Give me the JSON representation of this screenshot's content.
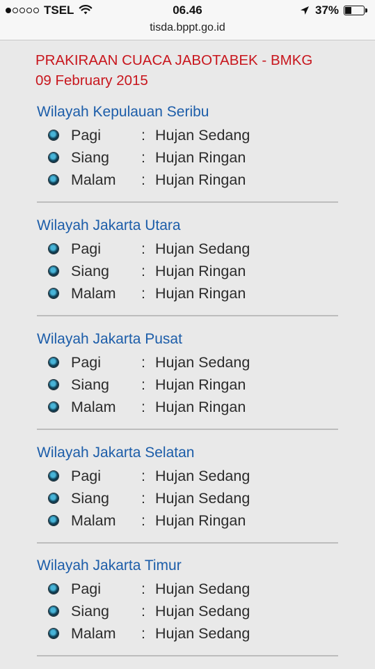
{
  "status_bar": {
    "carrier": "TSEL",
    "time": "06.46",
    "battery_percent": "37%",
    "battery_level": 0.37,
    "signal_bars_filled": 1,
    "signal_bars_total": 5
  },
  "browser": {
    "url": "tisda.bppt.go.id"
  },
  "page": {
    "title": "PRAKIRAAN CUACA JABOTABEK - BMKG 09 February 2015",
    "sections": [
      {
        "region": "Wilayah Kepulauan Seribu",
        "forecasts": [
          {
            "period": "Pagi",
            "colon": ":",
            "weather": "Hujan Sedang"
          },
          {
            "period": "Siang",
            "colon": ":",
            "weather": "Hujan Ringan"
          },
          {
            "period": "Malam",
            "colon": ":",
            "weather": "Hujan Ringan"
          }
        ]
      },
      {
        "region": "Wilayah Jakarta Utara",
        "forecasts": [
          {
            "period": "Pagi",
            "colon": ":",
            "weather": "Hujan Sedang"
          },
          {
            "period": "Siang",
            "colon": ":",
            "weather": "Hujan Ringan"
          },
          {
            "period": "Malam",
            "colon": ":",
            "weather": "Hujan Ringan"
          }
        ]
      },
      {
        "region": "Wilayah Jakarta Pusat",
        "forecasts": [
          {
            "period": "Pagi",
            "colon": ":",
            "weather": "Hujan Sedang"
          },
          {
            "period": "Siang",
            "colon": ":",
            "weather": "Hujan Ringan"
          },
          {
            "period": "Malam",
            "colon": ":",
            "weather": "Hujan Ringan"
          }
        ]
      },
      {
        "region": "Wilayah Jakarta Selatan",
        "forecasts": [
          {
            "period": "Pagi",
            "colon": ":",
            "weather": "Hujan Sedang"
          },
          {
            "period": "Siang",
            "colon": ":",
            "weather": "Hujan Sedang"
          },
          {
            "period": "Malam",
            "colon": ":",
            "weather": "Hujan Ringan"
          }
        ]
      },
      {
        "region": "Wilayah Jakarta Timur",
        "forecasts": [
          {
            "period": "Pagi",
            "colon": ":",
            "weather": "Hujan Sedang"
          },
          {
            "period": "Siang",
            "colon": ":",
            "weather": "Hujan Sedang"
          },
          {
            "period": "Malam",
            "colon": ":",
            "weather": "Hujan Sedang"
          }
        ]
      }
    ]
  },
  "colors": {
    "title": "#c8161d",
    "region": "#1c5da9",
    "text": "#2b2b2b",
    "background": "#e9e9e9"
  },
  "icons": {
    "wifi": "wifi-icon",
    "location": "location-arrow-icon",
    "battery": "battery-icon",
    "bullet": "bullet-icon"
  }
}
